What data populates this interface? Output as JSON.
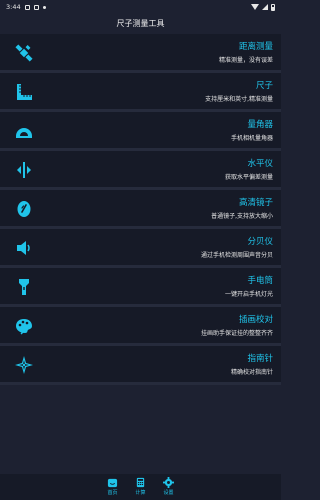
{
  "status_bar": {
    "time": "3:44"
  },
  "app_title": "尺子测量工具",
  "accent_color": "#20c4ea",
  "items": [
    {
      "icon": "ruler-satellite-icon",
      "title": "距离测量",
      "desc": "精准测量，没有误差"
    },
    {
      "icon": "ruler-icon",
      "title": "尺子",
      "desc": "支持厘米和英寸,精准测量"
    },
    {
      "icon": "protractor-icon",
      "title": "量角器",
      "desc": "手机相机量角器"
    },
    {
      "icon": "level-icon",
      "title": "水平仪",
      "desc": "获取水平偏差测量"
    },
    {
      "icon": "magnifier-icon",
      "title": "高清镜子",
      "desc": "普通镜子,支持放大缩小"
    },
    {
      "icon": "speaker-icon",
      "title": "分贝仪",
      "desc": "通过手机检测周围声音分贝"
    },
    {
      "icon": "flashlight-icon",
      "title": "手电筒",
      "desc": "一键开启手机灯光"
    },
    {
      "icon": "palette-icon",
      "title": "插画校对",
      "desc": "挂画助手保证挂的整整齐齐"
    },
    {
      "icon": "compass-icon",
      "title": "指南针",
      "desc": "精确校对指南针"
    }
  ],
  "bottom_nav": [
    {
      "icon": "home-icon",
      "label": "首页",
      "active": true
    },
    {
      "icon": "calculator-icon",
      "label": "计算",
      "active": false
    },
    {
      "icon": "gear-icon",
      "label": "设置",
      "active": false
    }
  ]
}
